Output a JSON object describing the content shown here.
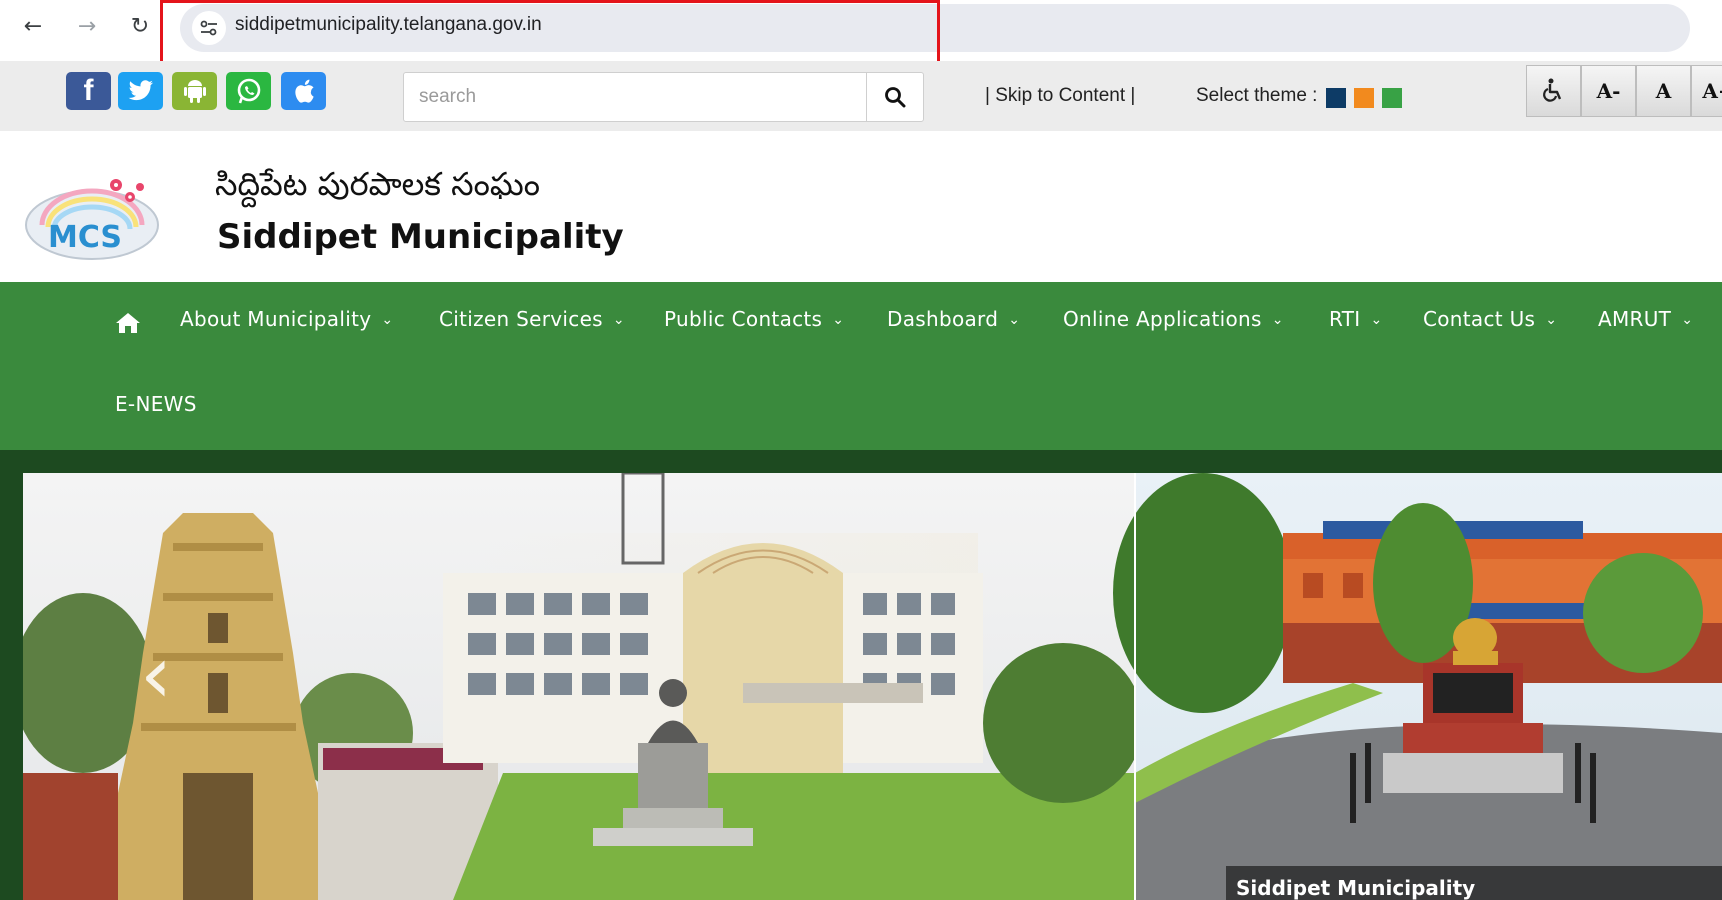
{
  "browser": {
    "url": "siddipetmunicipality.telangana.gov.in"
  },
  "utility": {
    "social": [
      {
        "name": "facebook",
        "label": "f",
        "color": "#3b5998"
      },
      {
        "name": "twitter",
        "label": "",
        "color": "#1da1f2"
      },
      {
        "name": "android",
        "label": "",
        "color": "#8ab534"
      },
      {
        "name": "whatsapp",
        "label": "",
        "color": "#2bb741"
      },
      {
        "name": "apple",
        "label": "",
        "color": "#2d8cf0"
      }
    ],
    "search_placeholder": "search",
    "skip_link": "| Skip to Content |",
    "theme_label": "Select theme :",
    "theme_colors": [
      "#0d3b66",
      "#f28a1e",
      "#38a245"
    ],
    "font_buttons": [
      "A-",
      "A",
      "A+"
    ]
  },
  "header": {
    "title_telugu": "సిద్దిపేట పురపాలక సంఘం",
    "title_english": "Siddipet Municipality",
    "logo_text": "MCS"
  },
  "nav": {
    "items": [
      {
        "label": "About Municipality",
        "caret": true
      },
      {
        "label": "Citizen Services",
        "caret": true
      },
      {
        "label": "Public Contacts",
        "caret": true
      },
      {
        "label": "Dashboard",
        "caret": true
      },
      {
        "label": "Online Applications",
        "caret": true
      },
      {
        "label": "RTI",
        "caret": true
      },
      {
        "label": "Contact Us",
        "caret": true
      },
      {
        "label": "AMRUT",
        "caret": true
      },
      {
        "label": "E-NEWS",
        "caret": false
      }
    ]
  },
  "slider": {
    "caption": "Siddipet Municipality",
    "prev_symbol": "‹"
  },
  "colors": {
    "nav_green": "#3a8a3d",
    "slider_frame": "#1d4a20",
    "highlight": "#e4141b"
  }
}
